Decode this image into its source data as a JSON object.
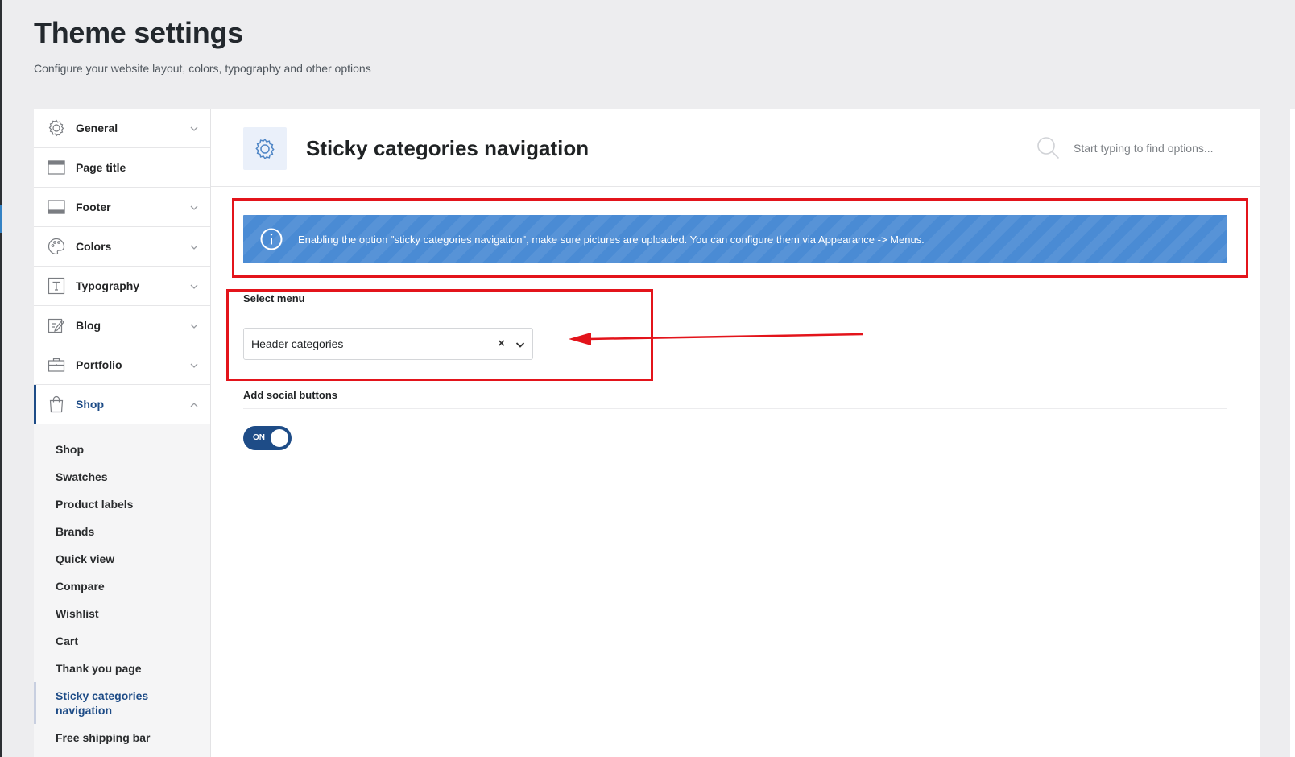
{
  "page": {
    "title": "Theme settings",
    "subtitle": "Configure your website layout, colors, typography and other options"
  },
  "sidebar": {
    "items": [
      {
        "label": "General",
        "icon": "gear-icon",
        "has_chevron": true
      },
      {
        "label": "Page title",
        "icon": "page-title-icon",
        "has_chevron": false
      },
      {
        "label": "Footer",
        "icon": "footer-icon",
        "has_chevron": true
      },
      {
        "label": "Colors",
        "icon": "palette-icon",
        "has_chevron": true
      },
      {
        "label": "Typography",
        "icon": "typography-icon",
        "has_chevron": true
      },
      {
        "label": "Blog",
        "icon": "edit-icon",
        "has_chevron": true
      },
      {
        "label": "Portfolio",
        "icon": "briefcase-icon",
        "has_chevron": true
      },
      {
        "label": "Shop",
        "icon": "shopping-bag-icon",
        "has_chevron": true,
        "active": true
      }
    ],
    "sub_items": [
      "Shop",
      "Swatches",
      "Product labels",
      "Brands",
      "Quick view",
      "Compare",
      "Wishlist",
      "Cart",
      "Thank you page",
      "Sticky categories navigation",
      "Free shipping bar"
    ],
    "active_sub_item": "Sticky categories navigation"
  },
  "content": {
    "section_title": "Sticky categories navigation",
    "section_icon": "gear-icon",
    "search": {
      "placeholder": "Start typing to find options..."
    },
    "notice": {
      "text": "Enabling the option \"sticky categories navigation\", make sure pictures are uploaded. You can configure them via Appearance -> Menus.",
      "icon": "info-icon"
    },
    "fields": {
      "select_menu": {
        "label": "Select menu",
        "value": "Header categories",
        "clear_symbol": "×"
      },
      "social_buttons": {
        "label": "Add social buttons",
        "toggle_text": "ON",
        "enabled": true
      }
    }
  },
  "colors": {
    "accent": "#1e4c87",
    "notice": "#4a8bd4",
    "annotation": "#e3141b"
  }
}
